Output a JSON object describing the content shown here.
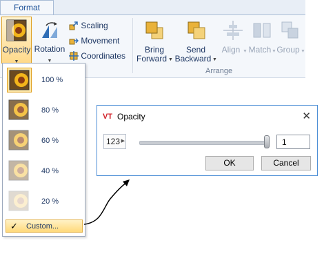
{
  "ribbon": {
    "tab_label": "Format",
    "buttons": {
      "opacity": "Opacity",
      "rotation": "Rotation",
      "scaling": "Scaling",
      "movement": "Movement",
      "coordinates": "Coordinates",
      "bring_forward_1": "Bring",
      "bring_forward_2": "Forward",
      "send_backward_1": "Send",
      "send_backward_2": "Backward",
      "align": "Align",
      "match": "Match",
      "group": "Group"
    },
    "group_label": "Arrange"
  },
  "opacity_menu": {
    "items": [
      {
        "label": "100 %",
        "opacity": 1.0
      },
      {
        "label": "80 %",
        "opacity": 0.8
      },
      {
        "label": "60 %",
        "opacity": 0.6
      },
      {
        "label": "40 %",
        "opacity": 0.4
      },
      {
        "label": "20 %",
        "opacity": 0.2
      }
    ],
    "selected_index": 0,
    "custom_label": "Custom...",
    "check_glyph": "✓"
  },
  "dialog": {
    "logo_text": "VT",
    "title": "Opacity",
    "close_glyph": "✕",
    "stepper_text": "123",
    "slider_value": 1,
    "value": "1",
    "ok_label": "OK",
    "cancel_label": "Cancel"
  },
  "colors": {
    "accent": "#1a4f96",
    "selection": "#ffd97a",
    "dialog_border": "#4d8fd6"
  }
}
